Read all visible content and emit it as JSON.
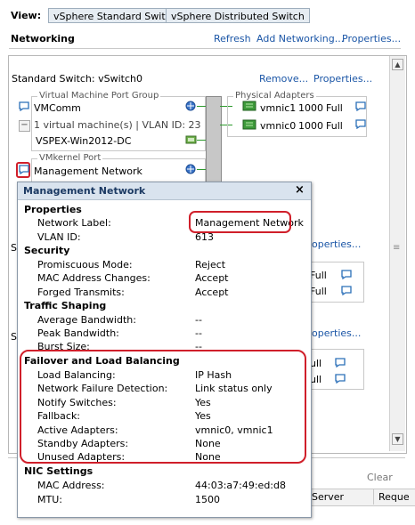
{
  "view": {
    "label": "View:",
    "standard_switch_button": "vSphere Standard Switch",
    "distributed_switch_button": "vSphere Distributed Switch"
  },
  "networking": {
    "title": "Networking",
    "refresh": "Refresh",
    "add_networking": "Add Networking...",
    "properties": "Properties..."
  },
  "switch": {
    "title": "Standard Switch: vSwitch0",
    "remove": "Remove...",
    "properties": "Properties...",
    "vm_port_group": {
      "group_title": "Virtual Machine Port Group",
      "name": "VMComm",
      "vm_count": "1 virtual machine(s) | VLAN ID: 23",
      "vm_name": "VSPEX-Win2012-DC"
    },
    "physical_adapters": {
      "group_title": "Physical Adapters",
      "adapters": [
        {
          "name": "vmnic1",
          "speed": "1000",
          "duplex": "Full"
        },
        {
          "name": "vmnic0",
          "speed": "1000",
          "duplex": "Full"
        }
      ]
    },
    "vmkernel": {
      "group_title": "VMkernel Port",
      "name": "Management Network"
    }
  },
  "background": {
    "s1": "S",
    "s2": "S",
    "properties_2": "operties...",
    "properties_3": "operties...",
    "full_rows": [
      "Full",
      "Full",
      "ull",
      "ull"
    ],
    "clear": "Clear",
    "col_server": "Server",
    "col_requested": "Reque"
  },
  "popup": {
    "title": "Management Network",
    "close": "×",
    "sections": {
      "properties": "Properties",
      "security": "Security",
      "traffic": "Traffic Shaping",
      "failover": "Failover and Load Balancing",
      "nic": "NIC Settings"
    },
    "properties": [
      {
        "label": "Network Label:",
        "value": "Management Network"
      },
      {
        "label": "VLAN ID:",
        "value": "613"
      }
    ],
    "security": [
      {
        "label": "Promiscuous Mode:",
        "value": "Reject"
      },
      {
        "label": "MAC Address Changes:",
        "value": "Accept"
      },
      {
        "label": "Forged Transmits:",
        "value": "Accept"
      }
    ],
    "traffic": [
      {
        "label": "Average Bandwidth:",
        "value": "--"
      },
      {
        "label": "Peak Bandwidth:",
        "value": "--"
      },
      {
        "label": "Burst Size:",
        "value": "--"
      }
    ],
    "failover": [
      {
        "label": "Load Balancing:",
        "value": "IP Hash"
      },
      {
        "label": "Network Failure Detection:",
        "value": "Link status only"
      },
      {
        "label": "Notify Switches:",
        "value": "Yes"
      },
      {
        "label": "Fallback:",
        "value": "Yes"
      },
      {
        "label": "Active Adapters:",
        "value": "vmnic0, vmnic1"
      },
      {
        "label": "Standby Adapters:",
        "value": "None"
      },
      {
        "label": "Unused Adapters:",
        "value": "None"
      }
    ],
    "nic": [
      {
        "label": "MAC Address:",
        "value": "44:03:a7:49:ed:d8"
      },
      {
        "label": "MTU:",
        "value": "1500"
      }
    ]
  },
  "colors": {
    "highlight": "#d01f2a",
    "link": "#1a55a6",
    "nic_green": "#2e9a2e"
  }
}
